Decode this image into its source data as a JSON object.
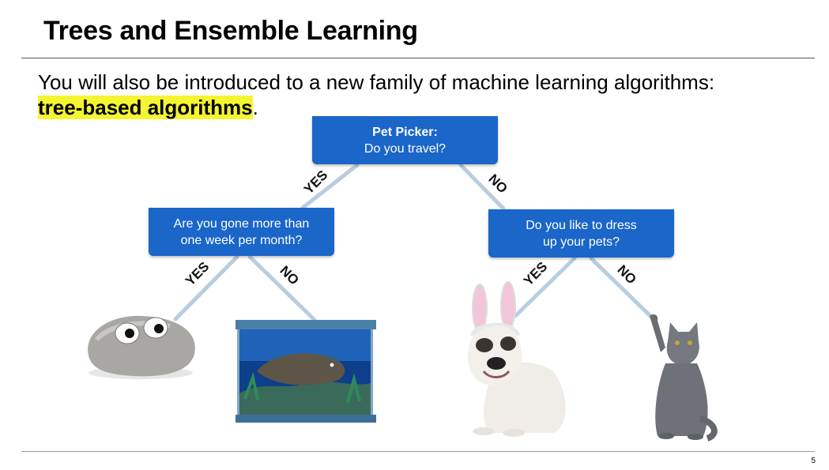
{
  "title": "Trees and Ensemble Learning",
  "intro": {
    "text": "You will also be introduced to a new family of machine learning algorithms:",
    "highlight": "tree-based algorithms",
    "period": "."
  },
  "tree": {
    "root": {
      "title": "Pet Picker:",
      "question": "Do you travel?"
    },
    "left": {
      "line1": "Are you gone more than",
      "line2": "one week per month?"
    },
    "right": {
      "line1": "Do you like to dress",
      "line2": "up your pets?"
    },
    "edge_labels": {
      "yes": "YES",
      "no": "NO"
    }
  },
  "leaves": [
    "pet rock",
    "fish tank",
    "dog in bunny ears",
    "cat"
  ],
  "colors": {
    "box": "#1a66c9",
    "edge": "#b8cde0",
    "highlight": "#f4f530"
  },
  "page_number": "5"
}
